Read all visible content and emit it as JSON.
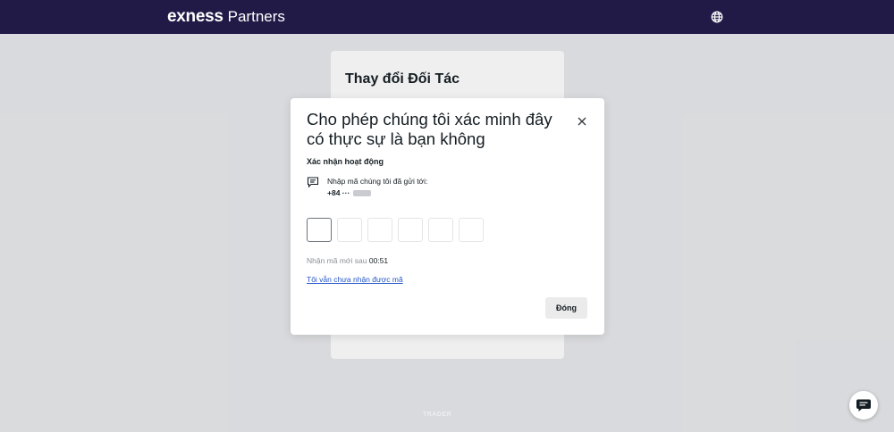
{
  "header": {
    "logo_brand": "exness",
    "logo_suffix": "Partners",
    "language_icon": "globe-icon"
  },
  "background_card": {
    "title": "Thay đổi Đối Tác"
  },
  "modal": {
    "title": "Cho phép chúng tôi xác minh đây có thực sự là bạn không",
    "close_icon": "close-icon",
    "subheading": "Xác nhận hoạt động",
    "sms_icon": "message-icon",
    "sent_to_label": "Nhập mã chúng tôi đã gửi tới:",
    "phone_prefix": "+84 ···",
    "otp_digits": [
      "",
      "",
      "",
      "",
      "",
      ""
    ],
    "resend_label": "Nhận mã mới sau",
    "resend_timer": "00:51",
    "no_code_link": "Tôi vẫn chưa nhận được mã",
    "close_button": "Đóng"
  },
  "footer": {
    "watermark": "TRADER"
  },
  "chat_widget": {
    "icon": "chat-icon"
  },
  "colors": {
    "header_bg": "#211a47",
    "link": "#2456c7",
    "page_bg": "#e6e7e9"
  }
}
